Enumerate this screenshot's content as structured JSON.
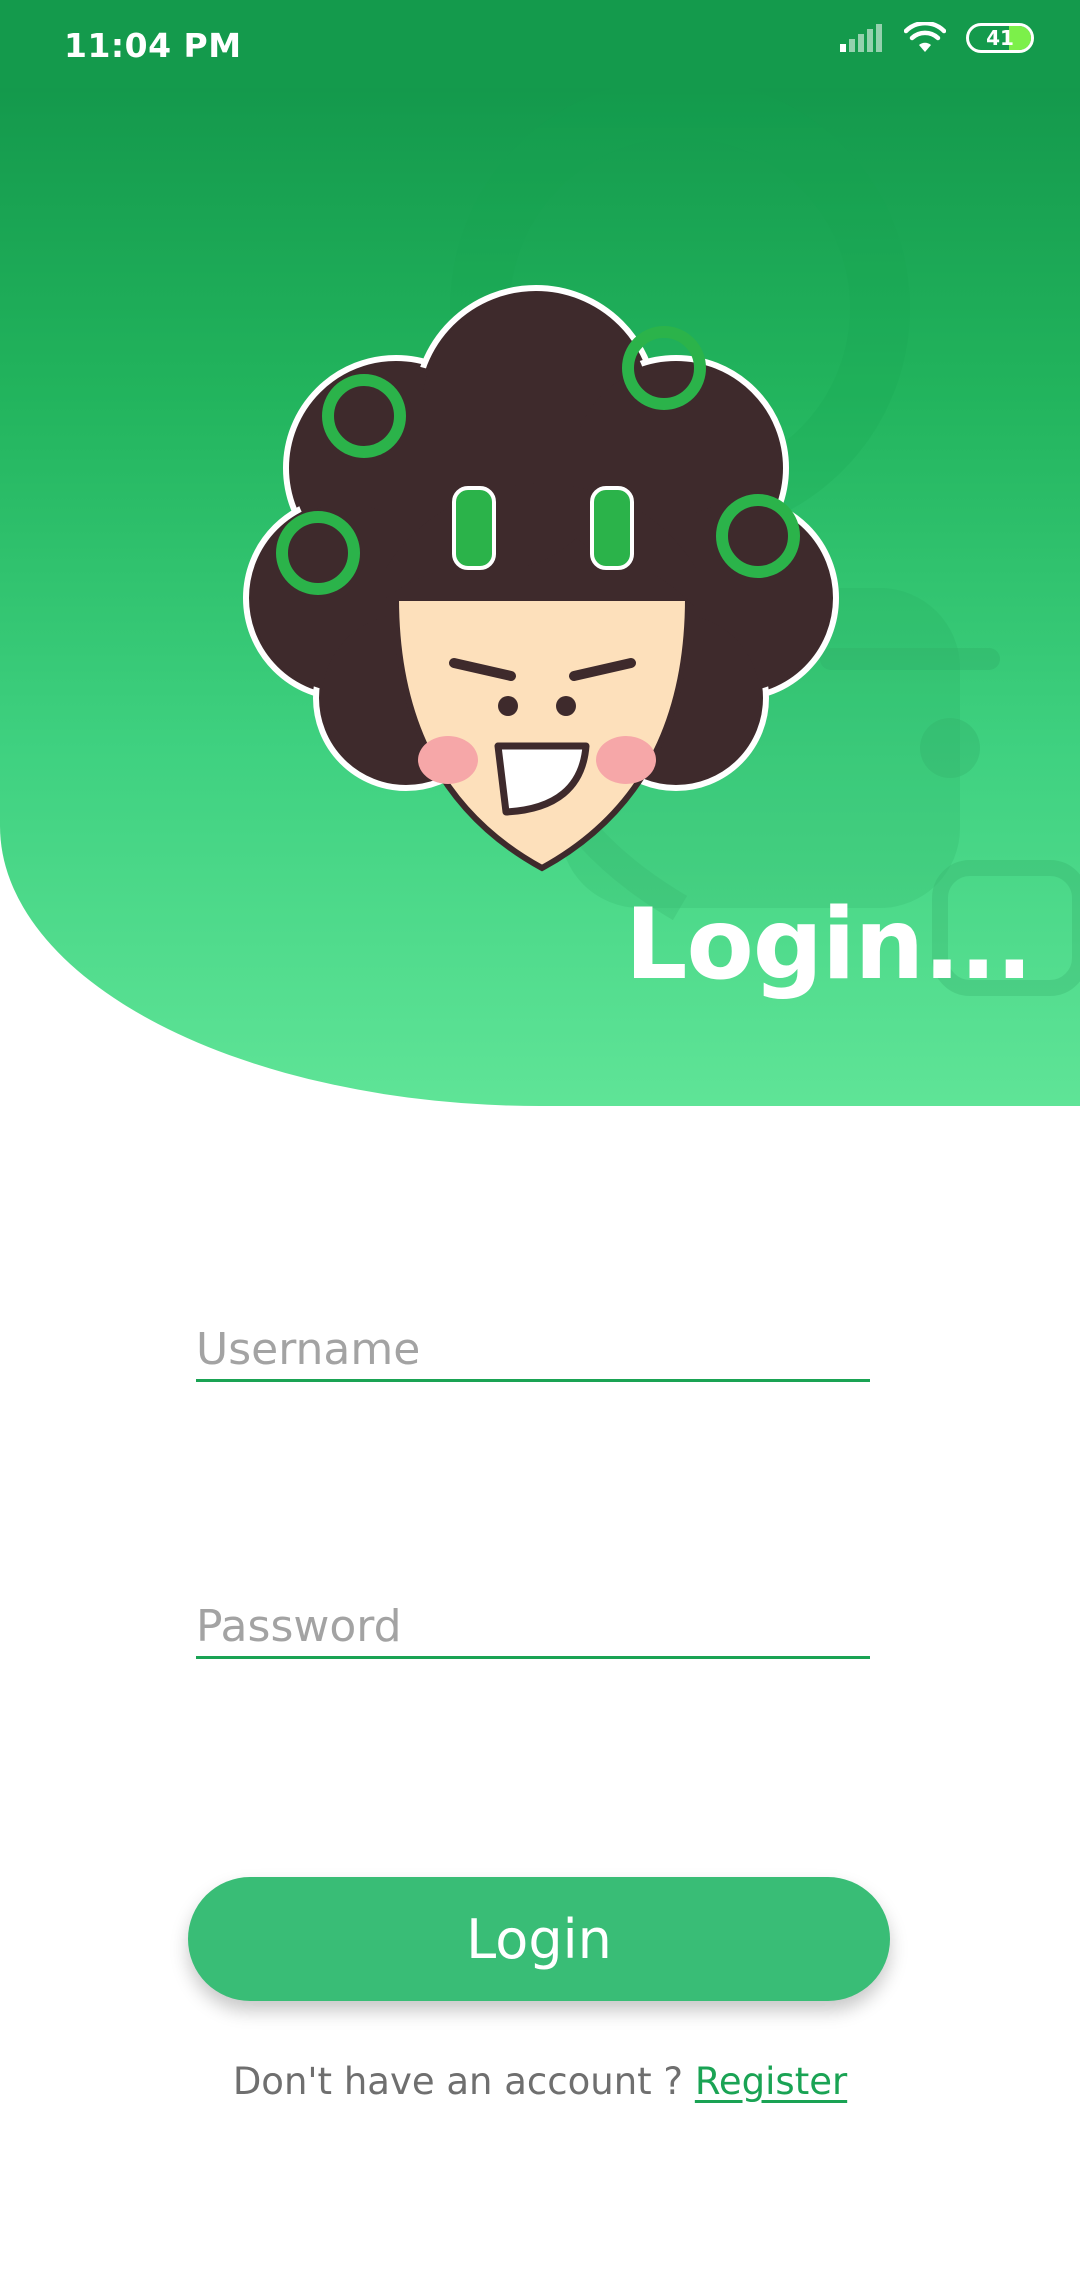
{
  "status_bar": {
    "time": "11:04 PM",
    "battery_level": "41",
    "signal_icon": "signal-bars-icon",
    "wifi_icon": "wifi-icon"
  },
  "header": {
    "title": "Login..."
  },
  "form": {
    "username_placeholder": "Username",
    "username_value": "",
    "password_placeholder": "Password",
    "password_value": "",
    "login_label": "Login"
  },
  "footer": {
    "prompt": "Don't have an account ?",
    "register_label": "Register"
  },
  "colors": {
    "accent": "#1aa354",
    "button": "#39bd76",
    "status_bar": "#149a4c"
  }
}
